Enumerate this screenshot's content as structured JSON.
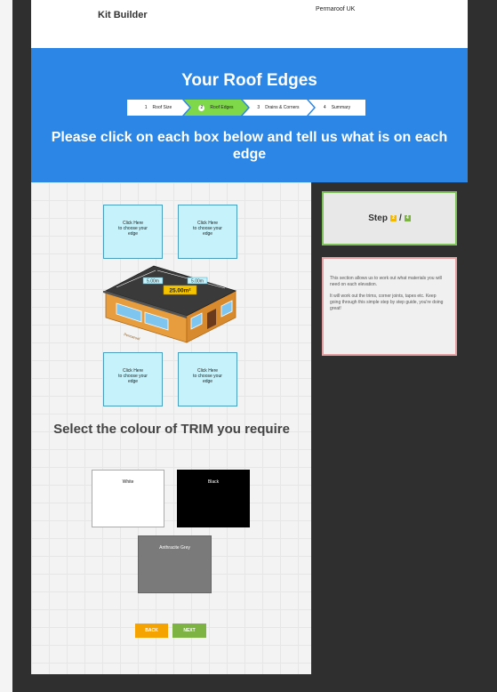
{
  "app_title": "Kit Builder",
  "brand": "Permaroof UK",
  "hero": {
    "title": "Your Roof Edges",
    "instruction": "Please click on each box below and tell us what is on each edge",
    "steps": [
      {
        "num": "1",
        "label": "Roof Size"
      },
      {
        "num": "2",
        "label": "Roof Edges"
      },
      {
        "num": "3",
        "label": "Drains & Corners"
      },
      {
        "num": "4",
        "label": "Summary"
      }
    ],
    "active_step": 2
  },
  "edge_boxes": [
    {
      "line1": "Click Here",
      "line2": "to choose your",
      "line3": "edge"
    },
    {
      "line1": "Click Here",
      "line2": "to choose your",
      "line3": "edge"
    },
    {
      "line1": "Click Here",
      "line2": "to choose your",
      "line3": "edge"
    },
    {
      "line1": "Click Here",
      "line2": "to choose your",
      "line3": "edge"
    }
  ],
  "house": {
    "dim_left": "5.00m",
    "dim_right": "5.00m",
    "area": "25.00m²",
    "sign": "Permaroof"
  },
  "trim": {
    "heading": "Select the colour of TRIM you require",
    "options": [
      {
        "label": "White",
        "color": "#ffffff",
        "text_color": "#222222"
      },
      {
        "label": "Black",
        "color": "#000000",
        "text_color": "#ffffff"
      },
      {
        "label": "Anthracite Grey",
        "color": "#7a7a7a",
        "text_color": "#ffffff"
      }
    ]
  },
  "buttons": {
    "back": "BACK",
    "next": "NEXT"
  },
  "step_card": {
    "label": "Step",
    "current": "2",
    "separator": "/",
    "total": "4",
    "current_color": "#f5b800",
    "total_color": "#7cb342"
  },
  "info": {
    "para1": "This section allows us to work out what materials you will need on each elevation.",
    "para2": "It will work out the trims, corner joints, tapes etc. Keep going through this simple step by step guide, you're doing great!"
  },
  "colors": {
    "hero_bg": "#2b86e6",
    "active_step": "#7fd84a",
    "back_button": "#f5a300",
    "next_button": "#7cb342"
  }
}
